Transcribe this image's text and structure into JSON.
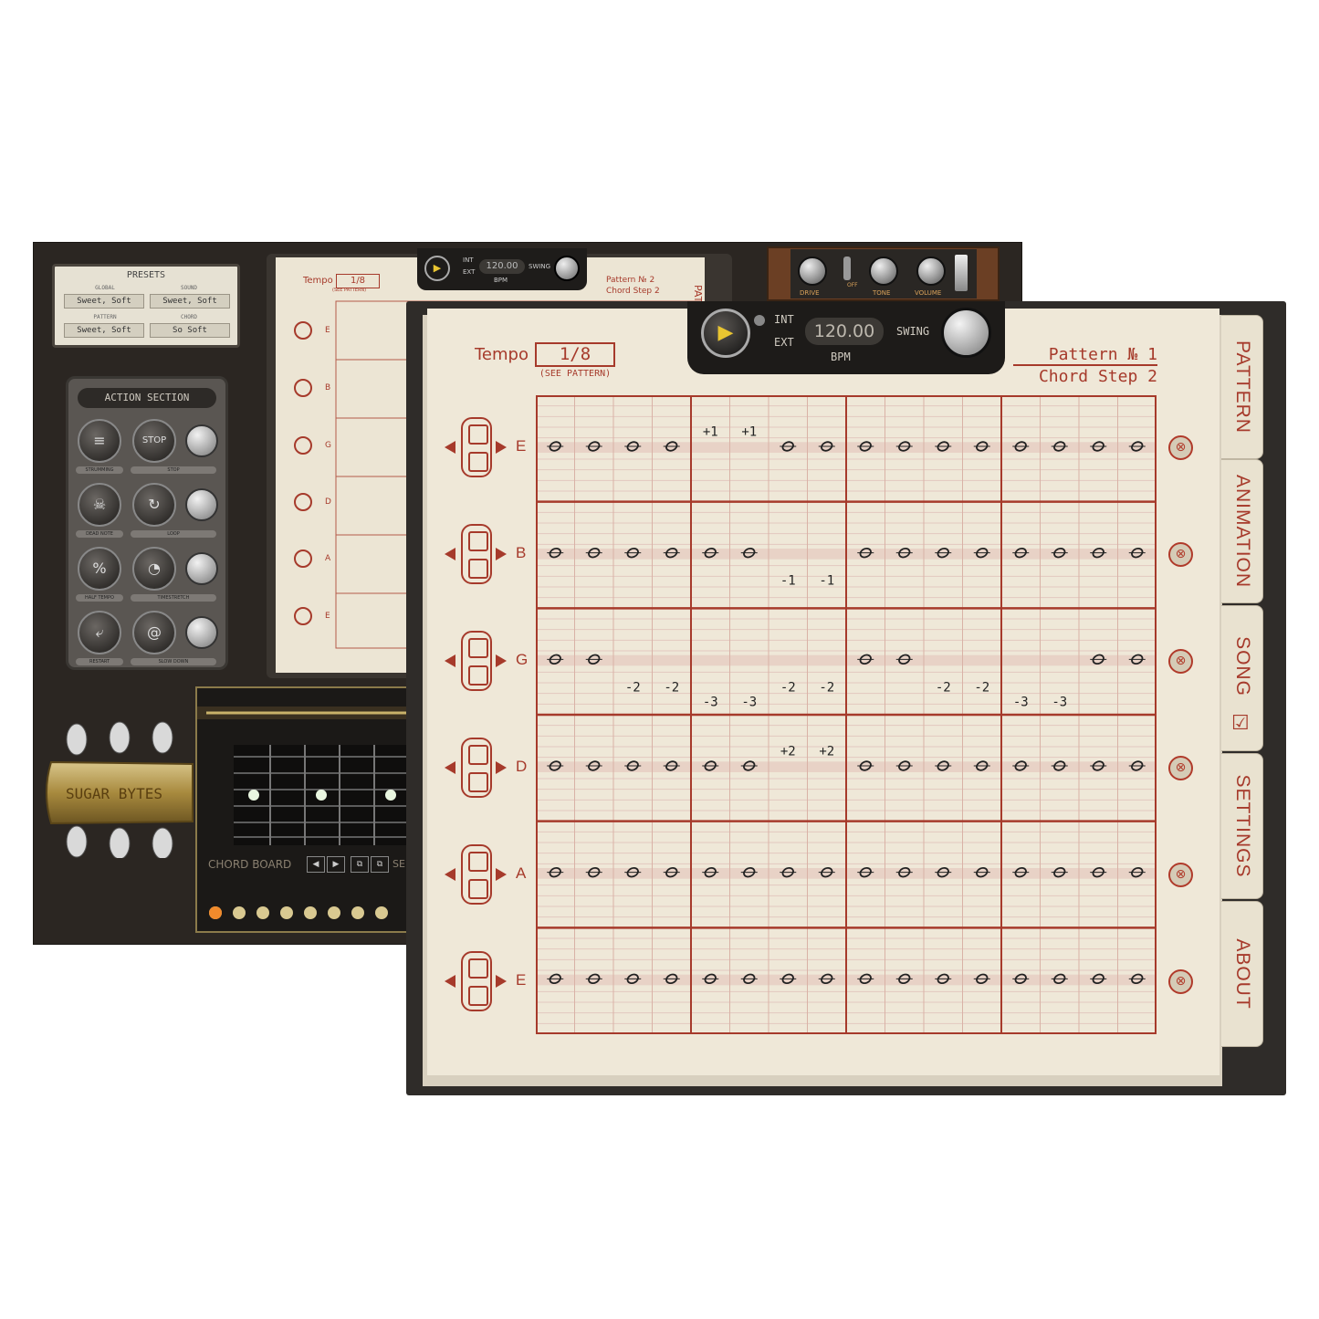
{
  "background_window": {
    "presets": {
      "title": "PRESETS",
      "global_label": "GLOBAL",
      "global_value": "Sweet, Soft",
      "sound_label": "SOUND",
      "sound_value": "Sweet, Soft",
      "pattern_label": "PATTERN",
      "pattern_value": "Sweet, Soft",
      "chord_label": "CHORD",
      "chord_value": "So Soft"
    },
    "action_section": {
      "title": "ACTION SECTION",
      "buttons": [
        "STRUMMING",
        "STOP",
        "DEAD NOTE",
        "LOOP",
        "HALF TEMPO",
        "TIMESTRETCH",
        "RESTART",
        "SLOW DOWN"
      ]
    },
    "mini_transport": {
      "int": "INT",
      "ext": "EXT",
      "bpm_value": "120.00",
      "bpm": "BPM",
      "swing": "SWING"
    },
    "mini_pattern": {
      "tempo_label": "Tempo",
      "tempo_value": "1/8",
      "see_pattern": "(SEE PATTERN)",
      "pattern_no": "Pattern № 2",
      "chord_step": "Chord Step 2",
      "tab": "PATT",
      "strings": [
        "E",
        "B",
        "G",
        "D",
        "A",
        "E"
      ]
    },
    "amp": {
      "drive": "DRIVE",
      "off": "OFF",
      "tone": "TONE",
      "volume": "VOLUME"
    },
    "logo": "SUGAR BYTES",
    "chord_board": {
      "label": "CHORD BOARD",
      "set": "SE"
    }
  },
  "transport": {
    "play_icon": "▶",
    "int": "INT",
    "ext": "EXT",
    "bpm_value": "120.00",
    "bpm_label": "BPM",
    "swing": "SWING"
  },
  "pattern": {
    "tempo_label": "Tempo",
    "tempo_value": "1/8",
    "see_pattern": "(SEE PATTERN)",
    "pattern_no": "Pattern № 1",
    "chord_step": "Chord Step 2"
  },
  "tabs": [
    "PATTERN",
    "ANIMATION",
    "SONG",
    "SETTINGS",
    "ABOUT"
  ],
  "song_checkbox": "☑",
  "strings": [
    "E",
    "B",
    "G",
    "D",
    "A",
    "E"
  ],
  "mute_icon": "⊗",
  "grid": {
    "steps": 16,
    "rows": [
      {
        "notes": [
          1,
          1,
          1,
          1,
          0,
          0,
          1,
          1,
          1,
          1,
          1,
          1,
          1,
          1,
          1,
          1
        ],
        "mods": [
          {
            "step": 5,
            "text": "+1",
            "pos": "above"
          },
          {
            "step": 6,
            "text": "+1",
            "pos": "above"
          }
        ]
      },
      {
        "notes": [
          1,
          1,
          1,
          1,
          1,
          1,
          0,
          0,
          1,
          1,
          1,
          1,
          1,
          1,
          1,
          1
        ],
        "mods": [
          {
            "step": 7,
            "text": "-1",
            "pos": "below"
          },
          {
            "step": 8,
            "text": "-1",
            "pos": "below"
          }
        ]
      },
      {
        "notes": [
          1,
          1,
          0,
          0,
          0,
          0,
          0,
          0,
          1,
          1,
          0,
          0,
          0,
          0,
          1,
          1
        ],
        "mods": [
          {
            "step": 3,
            "text": "-2",
            "pos": "below"
          },
          {
            "step": 4,
            "text": "-2",
            "pos": "below"
          },
          {
            "step": 5,
            "text": "-3",
            "pos": "low"
          },
          {
            "step": 6,
            "text": "-3",
            "pos": "low"
          },
          {
            "step": 7,
            "text": "-2",
            "pos": "below"
          },
          {
            "step": 8,
            "text": "-2",
            "pos": "below"
          },
          {
            "step": 11,
            "text": "-2",
            "pos": "below"
          },
          {
            "step": 12,
            "text": "-2",
            "pos": "below"
          },
          {
            "step": 13,
            "text": "-3",
            "pos": "low"
          },
          {
            "step": 14,
            "text": "-3",
            "pos": "low"
          }
        ]
      },
      {
        "notes": [
          1,
          1,
          1,
          1,
          1,
          1,
          0,
          0,
          1,
          1,
          1,
          1,
          1,
          1,
          1,
          1
        ],
        "mods": [
          {
            "step": 7,
            "text": "+2",
            "pos": "above"
          },
          {
            "step": 8,
            "text": "+2",
            "pos": "above"
          }
        ]
      },
      {
        "notes": [
          1,
          1,
          1,
          1,
          1,
          1,
          1,
          1,
          1,
          1,
          1,
          1,
          1,
          1,
          1,
          1
        ],
        "mods": []
      },
      {
        "notes": [
          1,
          1,
          1,
          1,
          1,
          1,
          1,
          1,
          1,
          1,
          1,
          1,
          1,
          1,
          1,
          1
        ],
        "mods": []
      }
    ]
  },
  "colors": {
    "accent": "#a63a2b",
    "paper": "#efe8d8",
    "dark": "#2b2622",
    "play": "#e9c531"
  }
}
